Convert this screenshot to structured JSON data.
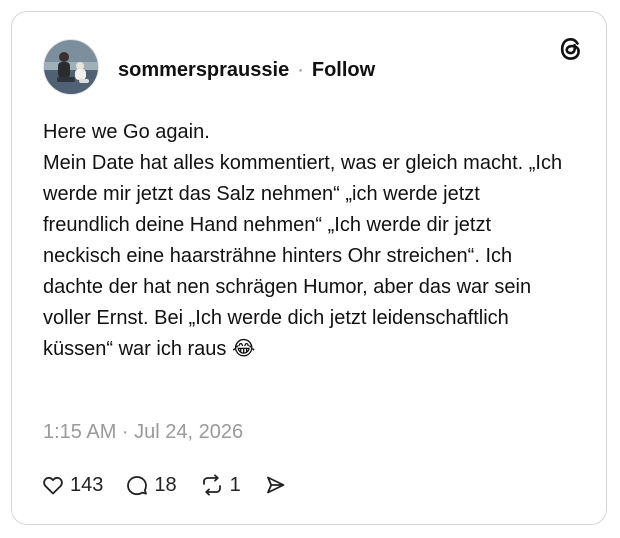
{
  "post": {
    "username": "sommerspraussie",
    "separator": "·",
    "follow_label": "Follow",
    "text_lines": [
      "Here we Go again.",
      "Mein Date hat alles kommentiert, was er gleich macht. „Ich werde mir jetzt das Salz nehmen“ „ich werde jetzt freundlich deine Hand nehmen“ „Ich werde dir jetzt neckisch eine haarsträhne hinters Ohr streichen“. Ich dachte der hat nen schrägen Humor, aber das war sein voller Ernst. Bei „Ich werde dich jetzt leidenschaftlich küssen“ war ich raus 😂"
    ],
    "timestamp": "1:15 AM · Jul 24, 2026"
  },
  "actions": {
    "likes": "143",
    "replies": "18",
    "reposts": "1"
  },
  "icons": {
    "logo": "threads-logo-icon",
    "like": "heart-icon",
    "reply": "speech-bubble-icon",
    "repost": "repost-icon",
    "share": "send-icon"
  },
  "colors": {
    "text": "#111111",
    "muted": "#9a9a9a",
    "border": "#d6d6d6"
  }
}
